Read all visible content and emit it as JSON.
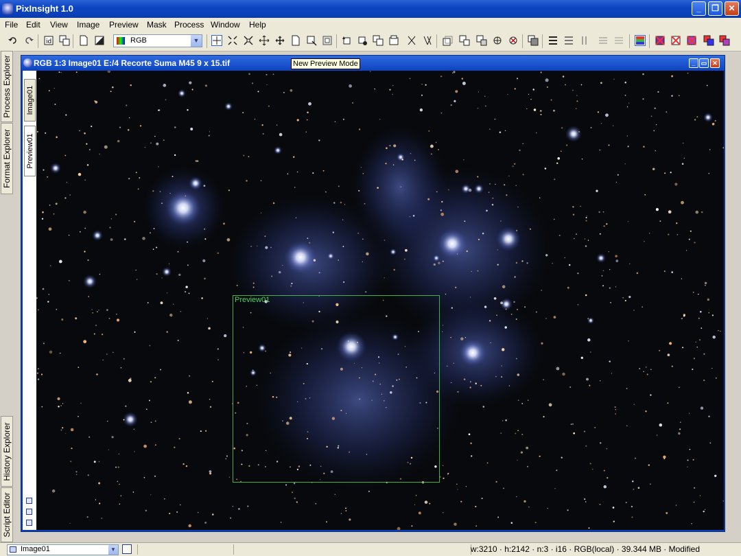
{
  "app": {
    "title": "PixInsight 1.0"
  },
  "window_controls": {
    "minimize": "_",
    "maximize": "❐",
    "close": "✕"
  },
  "menu": [
    "File",
    "Edit",
    "View",
    "Image",
    "Preview",
    "Mask",
    "Process",
    "Window",
    "Help"
  ],
  "toolbar": {
    "color_space": "RGB",
    "icons": [
      "undo-icon",
      "redo-icon",
      "image-info-icon",
      "duplicate-icon",
      "new-image-icon",
      "invert-icon",
      "readout-mode-icon",
      "zoom-in-icon",
      "zoom-out-icon",
      "pan-icon",
      "zoom-fit-icon",
      "new-preview-mode-icon",
      "edit-preview-icon",
      "fit-preview-icon",
      "rotate-icon",
      "crop-icon",
      "mask-icons",
      "channel-icons",
      "stf-icons"
    ]
  },
  "left_dock": {
    "tabs": [
      "Process Explorer",
      "Format Explorer",
      "History Explorer",
      "Script Editor"
    ]
  },
  "image_window": {
    "title": "RGB 1:3 Image01 E:/4 Recorte Suma M45 9 x 15.tif",
    "tabs": [
      "Image01",
      "Preview01"
    ],
    "preview_label": "Preview01"
  },
  "tooltip": "New Preview Mode",
  "statusbar": {
    "view": "Image01",
    "info": "w:3210 · h:2142 · n:3 · i16 · RGB(local) · 39.344 MB · Modified"
  },
  "colors": {
    "title_blue": "#0a3fb8",
    "nebula_blue": "#4e63c8",
    "preview_green": "#3fb24a"
  }
}
